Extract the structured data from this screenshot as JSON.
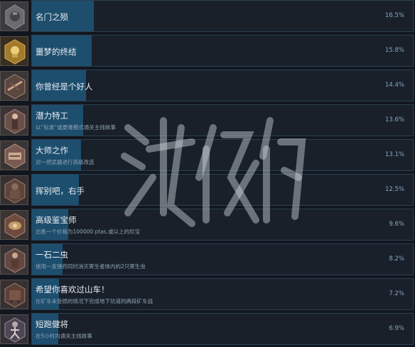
{
  "achievements": [
    {
      "name": "名门之殒",
      "desc": "",
      "percent": "16.5%",
      "progress": 0.165,
      "icon": "armored-knight-icon"
    },
    {
      "name": "噩梦的终结",
      "desc": "",
      "percent": "15.8%",
      "progress": 0.158,
      "icon": "golden-skull-icon"
    },
    {
      "name": "你曾经是个好人",
      "desc": "",
      "percent": "14.4%",
      "progress": 0.144,
      "icon": "crossbow-icon"
    },
    {
      "name": "潜力特工",
      "desc": "以“标准”或更难模式通关主线故事",
      "percent": "13.6%",
      "progress": 0.136,
      "icon": "agent-icon"
    },
    {
      "name": "大师之作",
      "desc": "对一把武器进行高级改造",
      "percent": "13.1%",
      "progress": 0.131,
      "icon": "weapon-case-icon"
    },
    {
      "name": "挥别吧，右手",
      "desc": "",
      "percent": "12.5%",
      "progress": 0.125,
      "icon": "giant-icon"
    },
    {
      "name": "高级鉴宝师",
      "desc": "出售一个价格为100000 ptas.或以上的珍宝",
      "percent": "9.6%",
      "progress": 0.096,
      "icon": "treasure-icon"
    },
    {
      "name": "一石二虫",
      "desc": "使用一发弹药同时消灭寄生者体内的2只寄生虫",
      "percent": "8.2%",
      "progress": 0.082,
      "icon": "parasite-icon"
    },
    {
      "name": "希望你喜欢过山车！",
      "desc": "在矿车未受损的情况下完成地下坑道的两段矿车战",
      "percent": "7.2%",
      "progress": 0.072,
      "icon": "mine-cart-icon"
    },
    {
      "name": "短跑健将",
      "desc": "在5小时内通关主线故事",
      "percent": "6.9%",
      "progress": 0.069,
      "icon": "sprinter-icon"
    }
  ]
}
